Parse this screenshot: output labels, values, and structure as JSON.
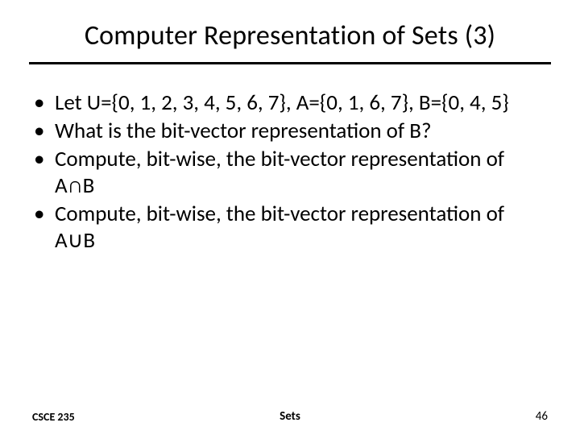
{
  "title": "Computer Representation of Sets (3)",
  "bullets": [
    "Let U={0, 1, 2, 3, 4, 5, 6, 7}, A={0, 1, 6, 7}, B={0, 4, 5}",
    "What is the bit-vector representation of B?",
    "Compute, bit-wise, the bit-vector representation of A∩B",
    "Compute, bit-wise, the bit-vector representation of A∪B"
  ],
  "footer": {
    "left": "CSCE 235",
    "center": "Sets",
    "right": "46"
  }
}
